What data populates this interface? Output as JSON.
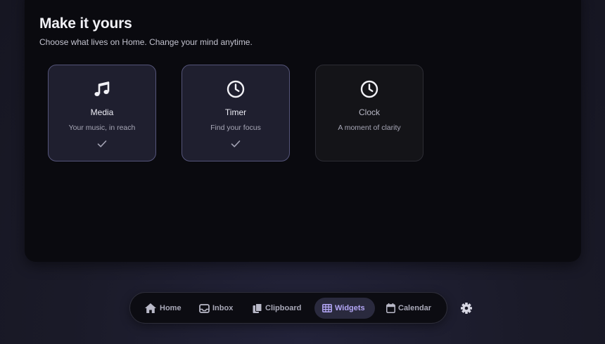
{
  "page": {
    "heading": "Make it yours",
    "subheading": "Choose what lives on Home. Change your mind anytime."
  },
  "widgets": [
    {
      "title": "Media",
      "description": "Your music, in reach",
      "icon": "music-note-icon",
      "selected": true
    },
    {
      "title": "Timer",
      "description": "Find your focus",
      "icon": "clock-icon",
      "selected": true
    },
    {
      "title": "Clock",
      "description": "A moment of clarity",
      "icon": "clock-icon",
      "selected": false
    }
  ],
  "nav": {
    "items": [
      {
        "label": "Home",
        "icon": "home-icon",
        "active": false
      },
      {
        "label": "Inbox",
        "icon": "inbox-icon",
        "active": false
      },
      {
        "label": "Clipboard",
        "icon": "clipboard-icon",
        "active": false
      },
      {
        "label": "Widgets",
        "icon": "grid-icon",
        "active": true
      },
      {
        "label": "Calendar",
        "icon": "calendar-icon",
        "active": false
      }
    ],
    "settings_icon": "gear-icon"
  },
  "colors": {
    "accent": "#b3a6f5",
    "active_tab_bg": "#2a2a3e",
    "panel_bg": "#0a0a0f",
    "selected_card_border": "#55557a"
  }
}
